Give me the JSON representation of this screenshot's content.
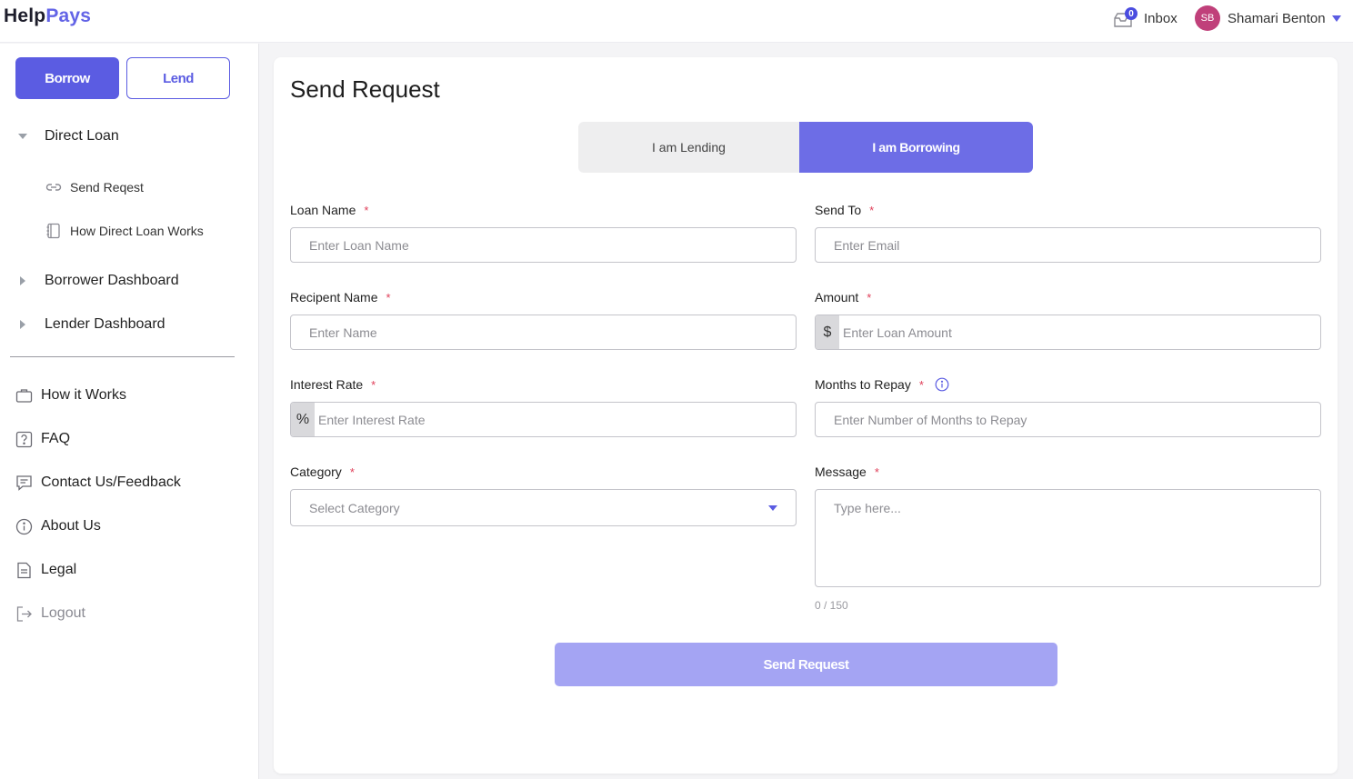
{
  "header": {
    "logo_part1": "Help",
    "logo_part2": "Pays",
    "inbox_label": "Inbox",
    "inbox_count": "0",
    "user_initials": "SB",
    "user_name": "Shamari Benton",
    "accent_color": "#5b5ce2"
  },
  "sidebar": {
    "borrow_label": "Borrow",
    "lend_label": "Lend",
    "direct_loan_label": "Direct Loan",
    "direct_loan_items": [
      {
        "label": "Send Reqest",
        "icon": "link-icon"
      },
      {
        "label": "How Direct Loan Works",
        "icon": "notebook-icon"
      }
    ],
    "borrower_dashboard_label": "Borrower Dashboard",
    "lender_dashboard_label": "Lender Dashboard",
    "links": [
      {
        "label": "How it Works",
        "icon": "briefcase-icon"
      },
      {
        "label": "FAQ",
        "icon": "question-icon"
      },
      {
        "label": "Contact Us/Feedback",
        "icon": "chat-icon"
      },
      {
        "label": "About Us",
        "icon": "info-icon"
      },
      {
        "label": "Legal",
        "icon": "document-icon"
      },
      {
        "label": "Logout",
        "icon": "logout-icon"
      }
    ]
  },
  "main": {
    "title": "Send Request",
    "toggle": {
      "lending_label": "I am Lending",
      "borrowing_label": "I am Borrowing",
      "selected": "I am Borrowing"
    },
    "fields": {
      "loan_name": {
        "label": "Loan Name",
        "required": "*",
        "placeholder": "Enter Loan Name",
        "value": ""
      },
      "send_to": {
        "label": "Send To",
        "required": "*",
        "placeholder": "Enter Email",
        "value": ""
      },
      "recipient_name": {
        "label": "Recipent Name",
        "required": "*",
        "placeholder": "Enter Name",
        "value": ""
      },
      "amount": {
        "label": "Amount",
        "required": "*",
        "prefix": "$",
        "placeholder": "Enter Loan Amount",
        "value": ""
      },
      "interest_rate": {
        "label": "Interest Rate",
        "required": "*",
        "prefix": "%",
        "placeholder": "Enter Interest Rate",
        "value": ""
      },
      "months_to_repay": {
        "label": "Months to Repay",
        "required": "*",
        "placeholder": "Enter Number of Months to Repay",
        "value": ""
      },
      "category": {
        "label": "Category",
        "required": "*",
        "selected": "Select Category"
      },
      "message": {
        "label": "Message",
        "required": "*",
        "placeholder": "Type here...",
        "value": "",
        "counter": "0 / 150"
      }
    },
    "submit_label": "Send Request"
  }
}
